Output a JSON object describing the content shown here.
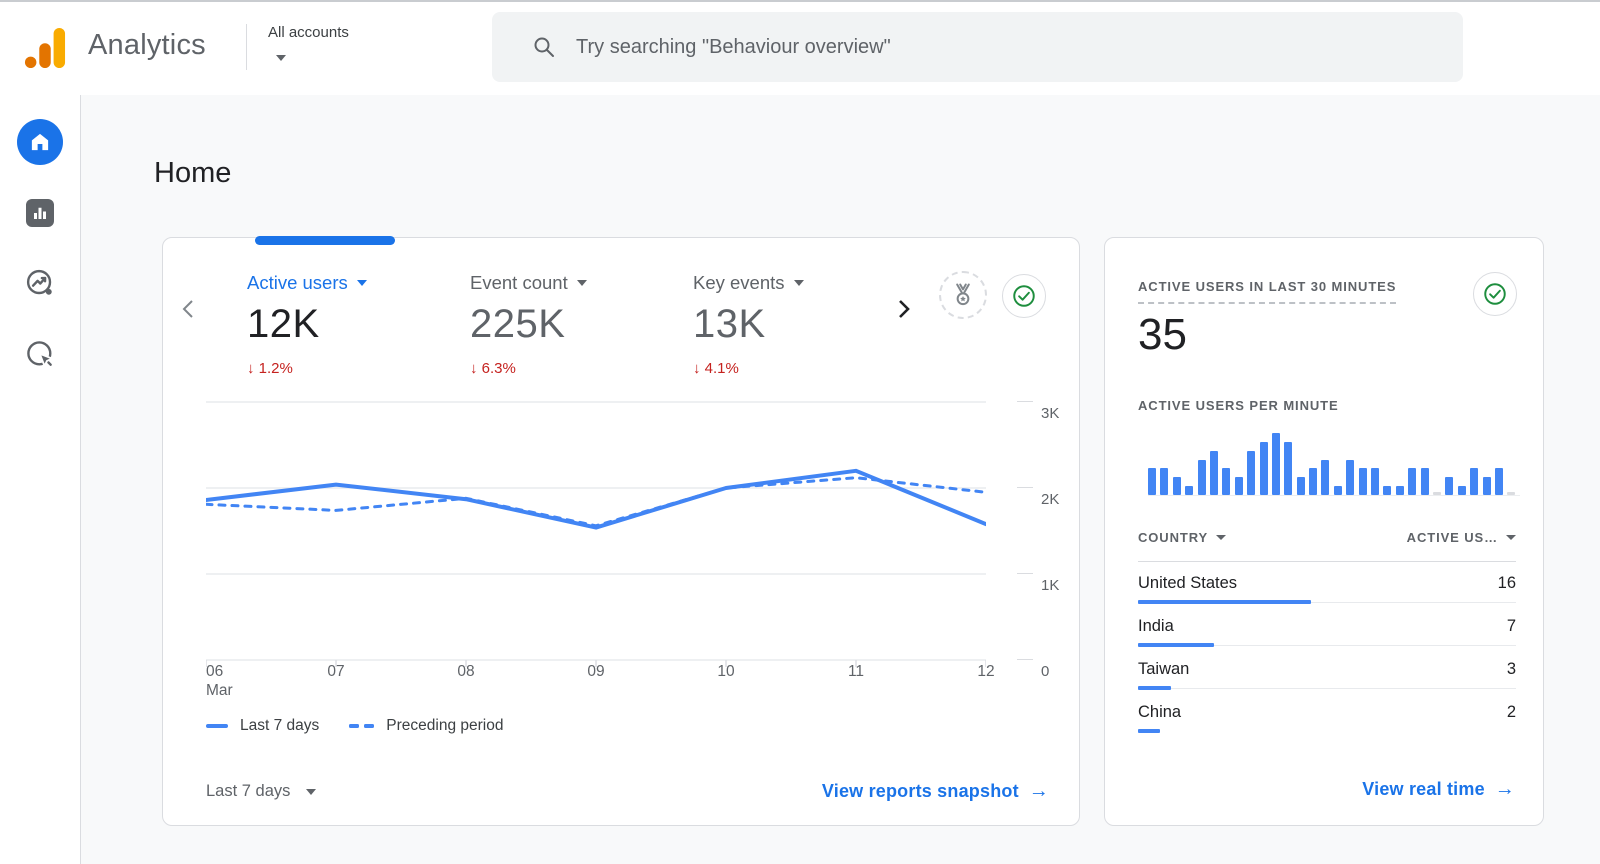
{
  "header": {
    "app_name": "Analytics",
    "account_label": "All accounts",
    "search_placeholder": "Try searching \"Behaviour overview\""
  },
  "sidebar": {
    "items": [
      {
        "name": "home",
        "active": true
      },
      {
        "name": "reports",
        "active": false
      },
      {
        "name": "explore",
        "active": false
      },
      {
        "name": "advertising",
        "active": false
      }
    ]
  },
  "page_title": "Home",
  "overview_card": {
    "metrics": [
      {
        "label": "Active users",
        "value": "12K",
        "arrow": "↓",
        "delta": "1.2%",
        "direction": "down",
        "selected": true
      },
      {
        "label": "Event count",
        "value": "225K",
        "arrow": "↓",
        "delta": "6.3%",
        "direction": "down",
        "selected": false
      },
      {
        "label": "Key events",
        "value": "13K",
        "arrow": "↓",
        "delta": "4.1%",
        "direction": "down",
        "selected": false
      }
    ],
    "chart_data": {
      "type": "line",
      "x": [
        "06",
        "07",
        "08",
        "09",
        "10",
        "11",
        "12"
      ],
      "x_sub": [
        "Mar",
        "",
        "",
        "",
        "",
        "",
        ""
      ],
      "series": [
        {
          "name": "Last 7 days",
          "style": "solid",
          "values": [
            1860,
            2040,
            1870,
            1540,
            2000,
            2200,
            1580
          ]
        },
        {
          "name": "Preceding period",
          "style": "dashed",
          "values": [
            1810,
            1740,
            1880,
            1560,
            2000,
            2120,
            1950
          ]
        }
      ],
      "ylim": [
        0,
        3000
      ],
      "yticks": [
        "3K",
        "2K",
        "1K",
        "0"
      ],
      "ytick_values": [
        3000,
        2000,
        1000,
        0
      ],
      "grid": true,
      "legend_position": "bottom"
    },
    "period_label": "Last 7 days",
    "view_link": "View reports snapshot",
    "view_link_arrow": "→"
  },
  "realtime_card": {
    "title": "ACTIVE USERS IN LAST 30 MINUTES",
    "value": "35",
    "per_minute_label": "ACTIVE USERS PER MINUTE",
    "chart_data": {
      "type": "bar",
      "title": "Active users per minute",
      "values": [
        3,
        3,
        2,
        1,
        4,
        5,
        3,
        2,
        5,
        6,
        7,
        6,
        2,
        3,
        4,
        1,
        4,
        3,
        3,
        1,
        1,
        3,
        3,
        0,
        2,
        1,
        3,
        2,
        3,
        0
      ],
      "ylim": [
        0,
        7
      ]
    },
    "table": {
      "columns": [
        "COUNTRY",
        "ACTIVE US…"
      ],
      "total": 35,
      "rows": [
        {
          "country": "United States",
          "active_users": 16
        },
        {
          "country": "India",
          "active_users": 7
        },
        {
          "country": "Taiwan",
          "active_users": 3
        },
        {
          "country": "China",
          "active_users": 2
        }
      ]
    },
    "view_link": "View real time",
    "view_link_arrow": "→"
  },
  "colors": {
    "accent_blue": "#1a73e8",
    "chart_blue": "#4285f4",
    "negative_red": "#c5221f",
    "check_green": "#1e8e3e",
    "logo_orange": "#e37400",
    "logo_yellow": "#f9ab00",
    "text_primary": "#202124",
    "text_secondary": "#5f6368",
    "border": "#dadce0",
    "content_bg": "#f8f9fa",
    "search_bg": "#f1f3f4"
  }
}
